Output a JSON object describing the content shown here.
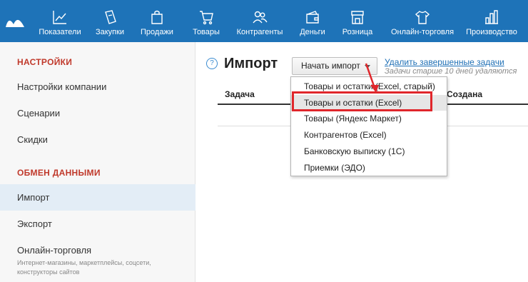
{
  "topnav": [
    {
      "label": "Показатели",
      "icon": "chart-line-icon"
    },
    {
      "label": "Закупки",
      "icon": "purchase-bag-icon"
    },
    {
      "label": "Продажи",
      "icon": "shopping-bag-icon"
    },
    {
      "label": "Товары",
      "icon": "cart-icon"
    },
    {
      "label": "Контрагенты",
      "icon": "people-icon"
    },
    {
      "label": "Деньги",
      "icon": "wallet-icon"
    },
    {
      "label": "Розница",
      "icon": "store-icon"
    },
    {
      "label": "Онлайн-торговля",
      "icon": "tshirt-icon"
    },
    {
      "label": "Производство",
      "icon": "factory-icon"
    }
  ],
  "sidebar": {
    "section1": "НАСТРОЙКИ",
    "items1": [
      "Настройки компании",
      "Сценарии",
      "Скидки"
    ],
    "section2": "ОБМЕН ДАННЫМИ",
    "items2": [
      "Импорт",
      "Экспорт",
      "Онлайн-торговля"
    ],
    "online_sub": "Интернет-магазины, маркетплейсы, соцсети, конструкторы сайтов"
  },
  "main": {
    "title": "Импорт",
    "start_button": "Начать импорт",
    "delete_link": "Удалить завершенные задачи",
    "hint": "Задачи старше 10 дней удаляются",
    "columns": [
      "Задача",
      "Создана"
    ]
  },
  "dropdown": {
    "items": [
      "Товары и остатки (Excel, старый)",
      "Товары и остатки (Excel)",
      "Товары (Яндекс Маркет)",
      "Контрагентов (Excel)",
      "Банковскую выписку (1С)",
      "Приемки (ЭДО)"
    ],
    "highlighted_index": 1
  },
  "colors": {
    "topbar": "#1e73b8",
    "section_heading": "#c0392b",
    "highlight_box": "#e0262b",
    "link": "#1e6fb5"
  }
}
